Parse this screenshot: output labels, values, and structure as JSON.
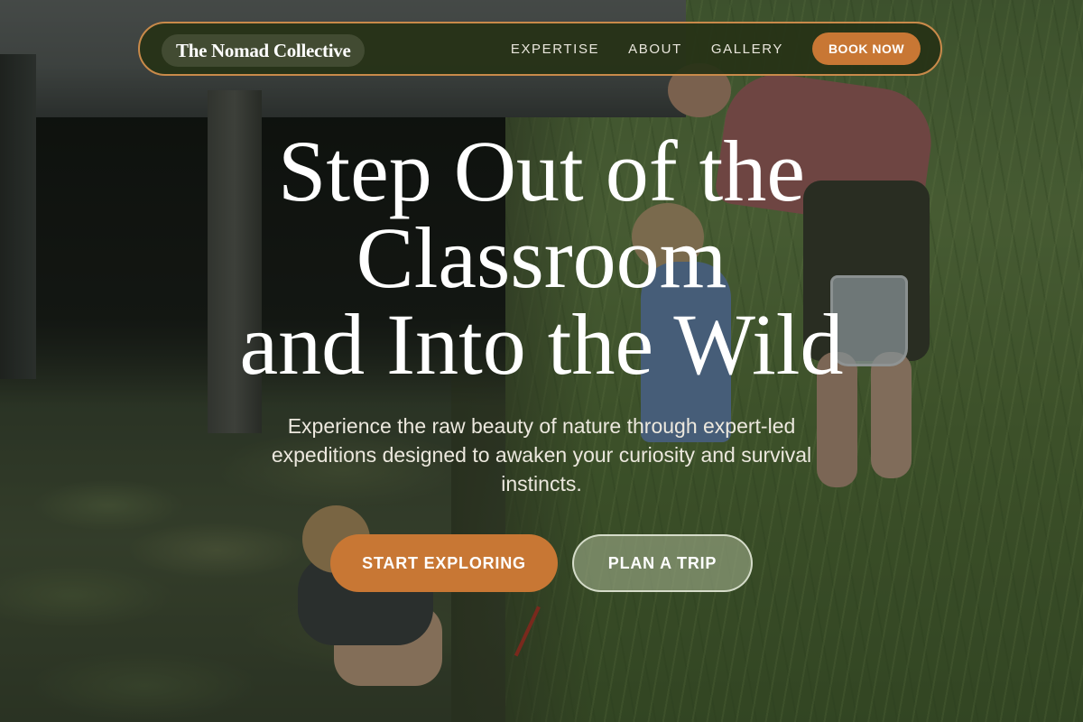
{
  "nav": {
    "brand": "The Nomad Collective",
    "links": [
      "EXPERTISE",
      "ABOUT",
      "GALLERY"
    ],
    "cta": "BOOK NOW"
  },
  "hero": {
    "title_lines": [
      "Step Out of the",
      "Classroom",
      "and Into the Wild"
    ],
    "subtitle": "Experience the raw beauty of nature through expert-led expeditions designed to awaken your curiosity and survival instincts.",
    "primary_button": "START EXPLORING",
    "secondary_button": "PLAN A TRIP"
  },
  "colors": {
    "accent": "#c87734",
    "nav_background": "#263216",
    "nav_border": "#c98a4a"
  },
  "background_image": "children-and-adult-exploring-marsh-shoreline"
}
